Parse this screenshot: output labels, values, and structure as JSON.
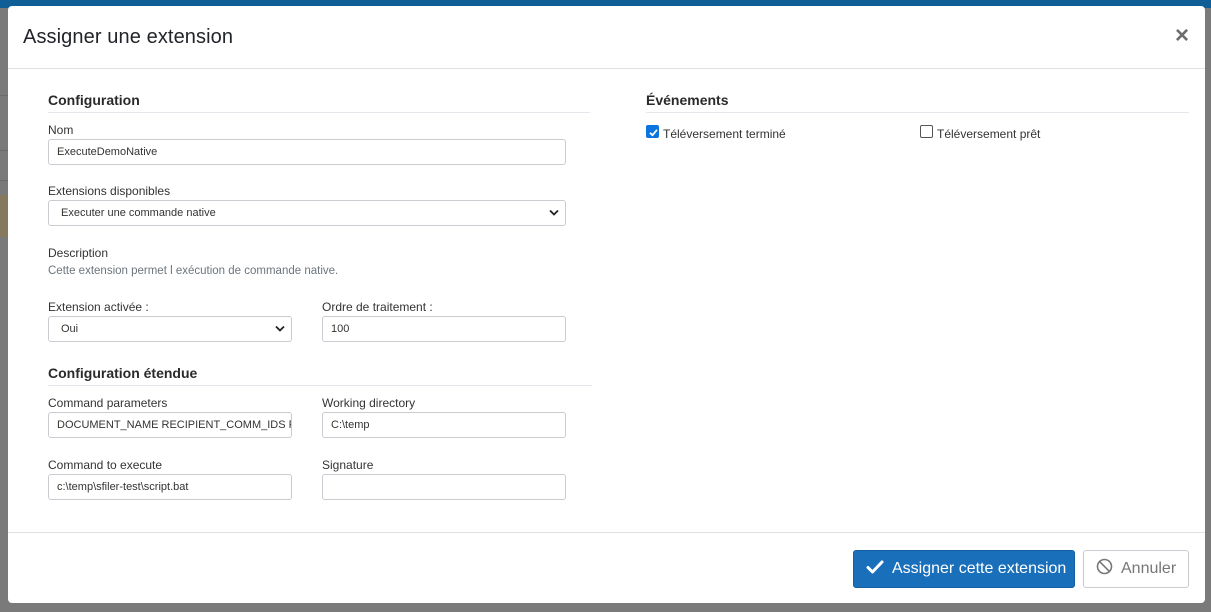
{
  "modal": {
    "title": "Assigner une extension",
    "close_glyph": "×"
  },
  "configuration": {
    "section_title": "Configuration",
    "name_label": "Nom",
    "name_value": "ExecuteDemoNative",
    "extensions_label": "Extensions disponibles",
    "extensions_selected": "Executer une commande native",
    "description_label": "Description",
    "description_text": "Cette extension permet l exécution de commande native.",
    "enabled_label": "Extension activée :",
    "enabled_selected": "Oui",
    "order_label": "Ordre de traitement :",
    "order_value": "100"
  },
  "extended": {
    "section_title": "Configuration étendue",
    "command_params_label": "Command parameters",
    "command_params_value": "DOCUMENT_NAME RECIPIENT_COMM_IDS RECIPIENT_",
    "working_dir_label": "Working directory",
    "working_dir_value": "C:\\temp",
    "command_label": "Command to execute",
    "command_value": "c:\\temp\\sfiler-test\\script.bat",
    "signature_label": "Signature",
    "signature_value": ""
  },
  "events": {
    "section_title": "Événements",
    "items": [
      {
        "label": "Téléversement terminé",
        "checked": true
      },
      {
        "label": "Téléversement prêt",
        "checked": false
      }
    ]
  },
  "footer": {
    "assign_label": "Assigner cette extension",
    "cancel_label": "Annuler"
  },
  "colors": {
    "primary": "#1a6fba",
    "topbar": "#0f5f96",
    "checkbox": "#0b74de"
  },
  "icons": {
    "close": "close-icon",
    "chevron": "chevron-down-icon",
    "check": "check-icon",
    "cancel": "ban-icon"
  }
}
